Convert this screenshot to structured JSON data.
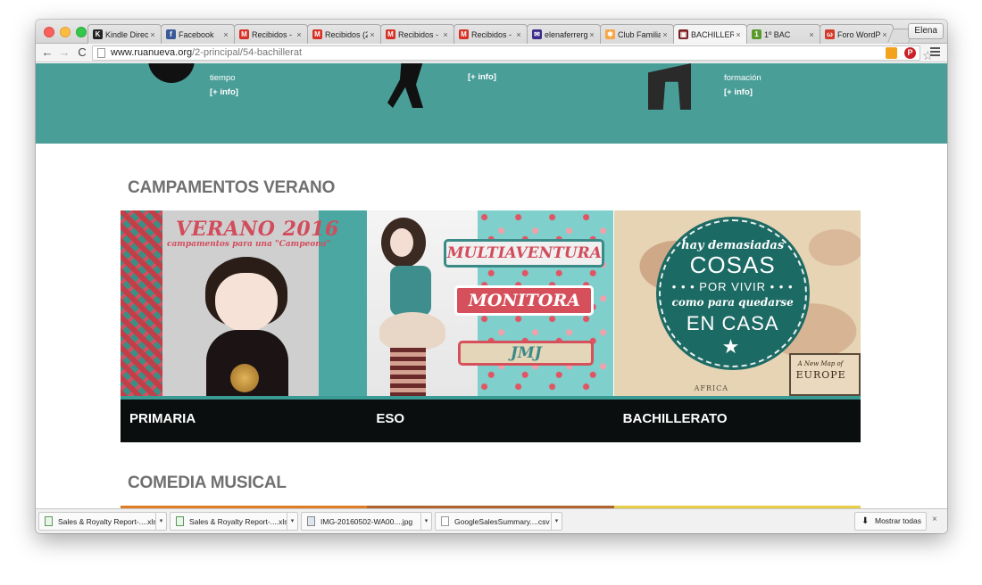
{
  "browser": {
    "tabs": [
      {
        "title": "Kindle Direc",
        "icon": "kindle-icon",
        "color": "#222222",
        "glyph": "K",
        "active": false
      },
      {
        "title": "Facebook",
        "icon": "facebook-icon",
        "color": "#3b5998",
        "glyph": "f",
        "active": false
      },
      {
        "title": "Recibidos -",
        "icon": "gmail-icon",
        "color": "#d93025",
        "glyph": "M",
        "active": false
      },
      {
        "title": "Recibidos (2",
        "icon": "gmail-icon",
        "color": "#d93025",
        "glyph": "M",
        "active": false
      },
      {
        "title": "Recibidos -",
        "icon": "gmail-icon",
        "color": "#d93025",
        "glyph": "M",
        "active": false
      },
      {
        "title": "Recibidos -",
        "icon": "gmail-icon",
        "color": "#d93025",
        "glyph": "M",
        "active": false
      },
      {
        "title": "elenaferrerg",
        "icon": "mail-icon",
        "color": "#3a2a8a",
        "glyph": "✉",
        "active": false
      },
      {
        "title": "Club Familia",
        "icon": "joomla-icon",
        "color": "#f9a541",
        "glyph": "✱",
        "active": false
      },
      {
        "title": "BACHILLER",
        "icon": "site-icon",
        "color": "#7a1e1e",
        "glyph": "▣",
        "active": true
      },
      {
        "title": "1º BAC",
        "icon": "site-icon-2",
        "color": "#5a9a2a",
        "glyph": "1",
        "active": false
      },
      {
        "title": "Foro WordPr",
        "icon": "wordpress-foro-icon",
        "color": "#d33a2a",
        "glyph": "ω",
        "active": false
      }
    ],
    "close_glyph": "×",
    "profile_name": "Elena",
    "url_host": "www.ruanueva.org",
    "url_path": "/2-principal/54-bachillerat",
    "nav": {
      "back": "←",
      "forward": "→",
      "reload": "C"
    },
    "star": "☆",
    "pinterest_glyph": "P"
  },
  "page": {
    "band": [
      {
        "text": "tiempo",
        "link": "[+ info]"
      },
      {
        "text": "",
        "link": "[+ info]"
      },
      {
        "text": "formación",
        "link": "[+ info]"
      }
    ],
    "section1_title": "CAMPAMENTOS VERANO",
    "section2_title": "COMEDIA MUSICAL",
    "cards": [
      {
        "label": "PRIMARIA"
      },
      {
        "label": "ESO"
      },
      {
        "label": "BACHILLERATO"
      }
    ],
    "card1_art": {
      "title": "VERANO 2016",
      "subtitle": "campamentos para una \"Campeona\""
    },
    "card2_art": {
      "box1": "MULTIAVENTURA",
      "box2": "MONITORA",
      "box3": "JMJ"
    },
    "card3_art": {
      "line1": "hay demasiadas",
      "line2": "COSAS",
      "line3": "• • • POR VIVIR • • •",
      "line4": "como para quedarse",
      "line5": "EN CASA",
      "map_caption": "A New Map of",
      "map_title": "EUROPE",
      "map_region": "AFRICA"
    }
  },
  "downloads": {
    "items": [
      {
        "name": "Sales & Royalty Report-....xls",
        "type": "sheet"
      },
      {
        "name": "Sales & Royalty Report-....xls",
        "type": "sheet"
      },
      {
        "name": "IMG-20160502-WA00....jpg",
        "type": "img"
      },
      {
        "name": "GoogleSalesSummary....csv",
        "type": "file"
      }
    ],
    "caret": "▾",
    "show_all": "Mostrar todas",
    "arrow": "⬇",
    "close": "×"
  }
}
